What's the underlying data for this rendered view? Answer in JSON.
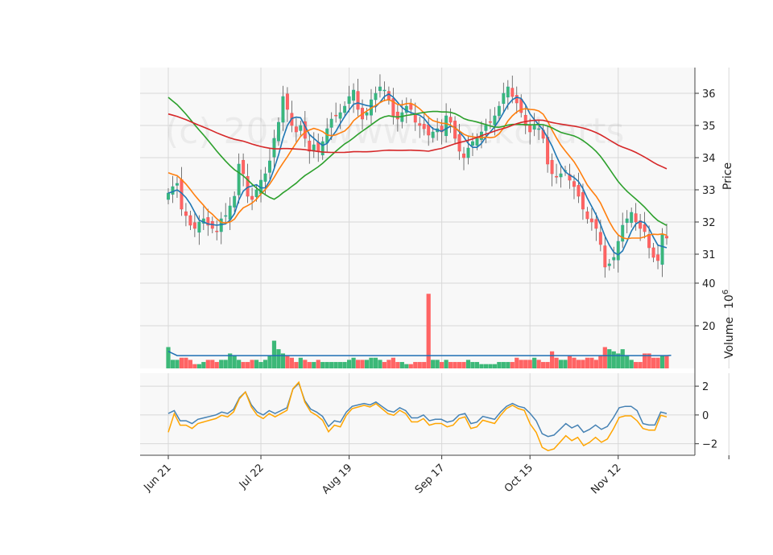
{
  "chart_data": {
    "type": "candlestick",
    "watermark": "(c) 2024 www.stockcharts",
    "colors": {
      "up": "#26a69a",
      "up_fill": "#3cb878",
      "down": "#ef5350",
      "down_fill": "#ff6464",
      "ma_fast": "#1f77b4",
      "ma_mid": "#ff7f0e",
      "ma_slow": "#2ca02c",
      "ma_long": "#d62728",
      "vol_ma": "#1f6fb4",
      "osc_a": "#4682b4",
      "osc_b": "#ffa500"
    },
    "x_ticks": [
      "Jun 21",
      "Jul 22",
      "Aug 19",
      "Sep 17",
      "Oct 15",
      "Nov 12",
      ""
    ],
    "x_tick_index": [
      0,
      21,
      41,
      62,
      82,
      102,
      126
    ],
    "price_axis": {
      "label": "Price",
      "ticks": [
        "31",
        "32",
        "33",
        "34",
        "35",
        "36"
      ],
      "ylim": [
        30.1,
        36.8
      ]
    },
    "volume_axis": {
      "label": "Volume",
      "exponent": "6",
      "ticks": [
        "20",
        "40"
      ],
      "ylim": [
        0,
        40
      ]
    },
    "osc_axis": {
      "ticks": [
        "−2",
        "0",
        "2"
      ],
      "ylim": [
        -2.8,
        2.9
      ]
    },
    "close": [
      32.9,
      33.1,
      33.2,
      32.4,
      32.2,
      31.9,
      31.8,
      32.0,
      32.1,
      31.9,
      31.8,
      31.7,
      32.1,
      32.2,
      32.5,
      32.8,
      33.8,
      33.5,
      32.8,
      32.7,
      33.0,
      33.3,
      33.5,
      33.9,
      34.6,
      35.1,
      35.9,
      35.5,
      35.0,
      34.8,
      35.0,
      34.6,
      34.2,
      34.4,
      34.2,
      34.5,
      34.9,
      35.2,
      35.3,
      35.4,
      35.6,
      35.9,
      36.1,
      35.5,
      35.2,
      35.4,
      35.8,
      36.0,
      36.2,
      36.1,
      35.8,
      35.3,
      35.2,
      35.4,
      35.6,
      35.5,
      35.1,
      35.0,
      34.9,
      34.7,
      34.8,
      34.9,
      34.8,
      35.3,
      35.1,
      34.6,
      34.2,
      34.0,
      34.3,
      34.5,
      34.6,
      34.8,
      35.0,
      35.1,
      35.3,
      35.6,
      36.0,
      36.2,
      35.9,
      35.7,
      35.4,
      35.0,
      34.8,
      35.0,
      34.9,
      34.6,
      33.8,
      33.5,
      33.4,
      33.5,
      33.6,
      33.3,
      33.1,
      32.8,
      32.4,
      32.1,
      32.0,
      31.8,
      31.3,
      30.6,
      30.7,
      30.9,
      31.4,
      31.9,
      32.1,
      32.3,
      32.0,
      31.8,
      31.7,
      31.2,
      30.9,
      30.8,
      31.6,
      31.5
    ],
    "ohlc_note": "open/high/low derived from close for rendering",
    "volume": [
      10,
      4,
      4,
      5,
      5,
      4,
      2,
      2,
      3,
      4,
      4,
      3,
      4,
      4,
      7,
      6,
      4,
      3,
      3,
      4,
      4,
      3,
      4,
      6,
      13,
      9,
      7,
      6,
      5,
      3,
      5,
      4,
      3,
      3,
      4,
      3,
      3,
      3,
      3,
      3,
      3,
      4,
      5,
      4,
      4,
      4,
      5,
      5,
      4,
      3,
      4,
      5,
      3,
      3,
      2,
      2,
      3,
      3,
      3,
      35,
      4,
      4,
      3,
      4,
      3,
      3,
      3,
      3,
      4,
      3,
      3,
      2,
      2,
      2,
      2,
      3,
      3,
      3,
      3,
      5,
      4,
      4,
      4,
      5,
      4,
      3,
      3,
      8,
      5,
      4,
      4,
      6,
      5,
      4,
      4,
      5,
      5,
      4,
      6,
      10,
      9,
      8,
      7,
      9,
      6,
      4,
      3,
      3,
      7,
      7,
      5,
      5,
      6,
      6,
      7
    ],
    "osc_a": [
      0.1,
      0.3,
      -0.4,
      -0.4,
      -0.6,
      -0.3,
      -0.2,
      -0.1,
      0.0,
      0.2,
      0.1,
      0.4,
      1.2,
      1.6,
      0.7,
      0.2,
      0.0,
      0.3,
      0.1,
      0.3,
      0.5,
      1.8,
      2.2,
      1.0,
      0.4,
      0.2,
      -0.1,
      -0.8,
      -0.4,
      -0.5,
      0.2,
      0.6,
      0.7,
      0.8,
      0.7,
      0.9,
      0.6,
      0.3,
      0.2,
      0.5,
      0.3,
      -0.2,
      -0.2,
      0.0,
      -0.4,
      -0.3,
      -0.3,
      -0.5,
      -0.4,
      0.0,
      0.1,
      -0.6,
      -0.5,
      -0.1,
      -0.2,
      -0.3,
      0.2,
      0.6,
      0.8,
      0.6,
      0.5,
      0.1,
      -0.4,
      -1.3,
      -1.5,
      -1.4,
      -1.0,
      -0.6,
      -0.9,
      -0.7,
      -1.2,
      -1.0,
      -0.7,
      -1.0,
      -0.8,
      -0.2,
      0.5,
      0.6,
      0.6,
      0.3,
      -0.6,
      -0.7,
      -0.7,
      0.2,
      0.1
    ]
  },
  "labels": {
    "price": "Price",
    "volume": "Volume",
    "exp_base": "10",
    "exp": "6"
  }
}
